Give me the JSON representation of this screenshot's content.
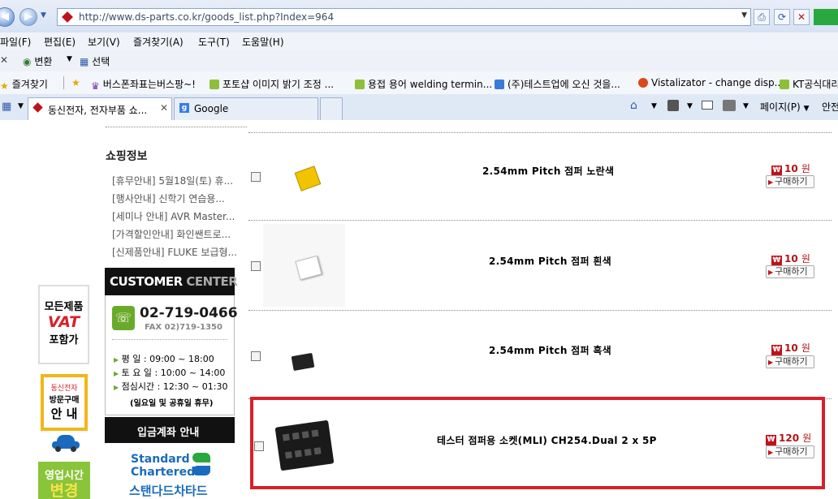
{
  "browser": {
    "url": "http://www.ds-parts.co.kr/goods_list.php?Index=964",
    "menu": [
      "파일(F)",
      "편집(E)",
      "보기(V)",
      "즐겨찾기(A)",
      "도구(T)",
      "도움말(H)"
    ],
    "translate_label": "변환",
    "select_label": "선택",
    "favorites_label": "즐겨찾기",
    "favorites": [
      "버스폰좌표는버스팡~!",
      "포토샵 이미지 밝기 조정 ...",
      "용접 용어 welding termin...",
      "(주)테스트업에 오신 것을...",
      "Vistalizator - change disp...",
      "KT공식대리"
    ],
    "tabs": [
      {
        "label": "동신전자, 전자부품 쇼..."
      },
      {
        "label": "Google"
      }
    ],
    "page_menu": "페이지(P)",
    "safety_menu": "안전"
  },
  "sidebar": {
    "shopping_title": "쇼핑정보",
    "notices": [
      "[휴무안내] 5월18일(토) 휴...",
      "[행사안내] 신학기 연습용...",
      "[세미나 안내] AVR Master...",
      "[가격할인안내] 화인쌘트로...",
      "[신제품안내] FLUKE 보급형..."
    ],
    "customer_center": {
      "title_a": "CUSTOMER",
      "title_b": " CENTER",
      "phone": "02-719-0466",
      "fax": "FAX 02)719-1350",
      "hours": [
        {
          "label": "평     일",
          "time": ": 09:00 ~ 18:00"
        },
        {
          "label": "토 요 일",
          "time": ": 10:00 ~ 14:00"
        },
        {
          "label": "점심시간",
          "time": ": 12:30 ~ 01:30"
        }
      ],
      "holiday_note": "(일요일 및 공휴일 휴무)"
    },
    "bank_title": "입금계좌 안내",
    "bank": {
      "en_line1": "Standard",
      "en_line2": "Chartered",
      "ko": "스탠다드차타드"
    }
  },
  "left_banners": {
    "vat": {
      "line1": "모든제품",
      "line2": "VAT",
      "line3": "포함가"
    },
    "visit": {
      "line1": "동신전자",
      "line2": "방문구매",
      "line3": "안  내"
    },
    "hours": {
      "line1": "영업시간",
      "line2": "변경"
    }
  },
  "products": [
    {
      "name": "2.54mm Pitch 점퍼 노란색",
      "price": "10",
      "unit": "원",
      "buy": "구매하기",
      "won": "₩",
      "color": "#f2c400"
    },
    {
      "name": "2.54mm Pitch 점퍼 흰색",
      "price": "10",
      "unit": "원",
      "buy": "구매하기",
      "won": "₩",
      "color": "#ffffff"
    },
    {
      "name": "2.54mm Pitch 점퍼 흑색",
      "price": "10",
      "unit": "원",
      "buy": "구매하기",
      "won": "₩",
      "color": "#222222"
    },
    {
      "name": "테스터 점퍼용 소켓(MLI) CH254.Dual 2 x 5P",
      "price": "120",
      "unit": "원",
      "buy": "구매하기",
      "won": "₩",
      "color": "#1a1a1a"
    }
  ],
  "colors": {
    "highlight_border": "#d8202a",
    "price_red": "#b31313",
    "brand_red": "#c0121a"
  }
}
